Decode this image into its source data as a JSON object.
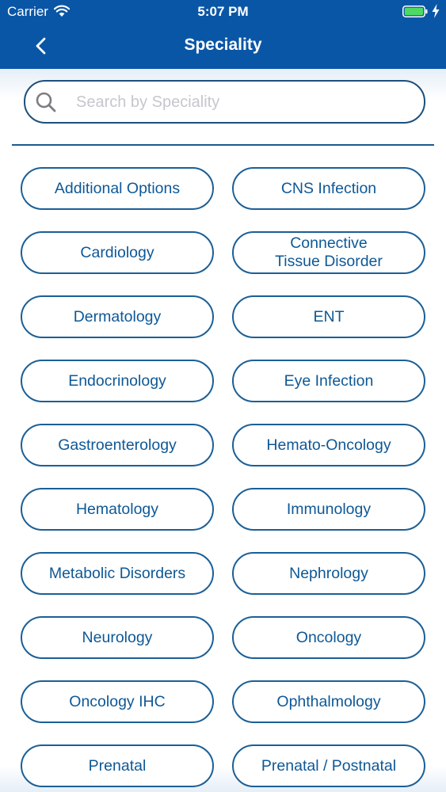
{
  "status_bar": {
    "carrier": "Carrier",
    "time": "5:07 PM",
    "wifi_icon": "wifi-icon",
    "battery_icon": "battery-icon",
    "charging_icon": "bolt-icon",
    "battery_color": "#4cd964"
  },
  "nav": {
    "title": "Speciality",
    "back_icon": "chevron-left-icon"
  },
  "search": {
    "placeholder": "Search by Speciality",
    "value": "",
    "icon": "search-icon"
  },
  "colors": {
    "header": "#0a56a6",
    "accent": "#0e5896",
    "pill_border": "#1b5f96"
  },
  "specialities": [
    "Additional Options",
    "CNS Infection",
    "Cardiology",
    "Connective\nTissue Disorder",
    "Dermatology",
    "ENT",
    "Endocrinology",
    "Eye Infection",
    "Gastroenterology",
    "Hemato-Oncology",
    "Hematology",
    "Immunology",
    "Metabolic Disorders",
    "Nephrology",
    "Neurology",
    "Oncology",
    "Oncology IHC",
    "Ophthalmology",
    "Prenatal",
    "Prenatal / Postnatal"
  ]
}
